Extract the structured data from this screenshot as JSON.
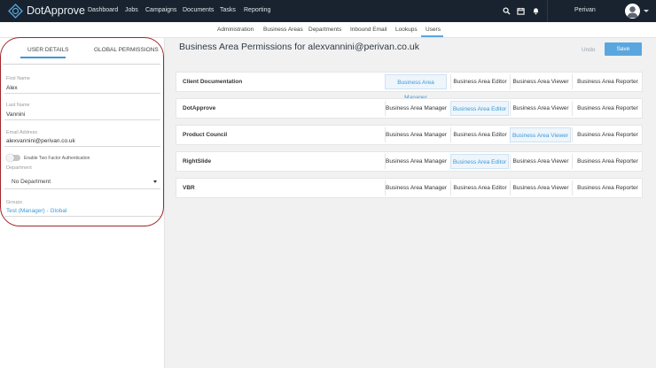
{
  "app": {
    "brand": "DotApprove",
    "nav": [
      "Dashboard",
      "Jobs",
      "Campaigns",
      "Documents",
      "Tasks",
      "Reporting"
    ],
    "icons": [
      "search-icon",
      "calendar-icon",
      "bell-icon"
    ],
    "user": "Perivan"
  },
  "subnav": {
    "items": [
      "Administration",
      "Business Areas",
      "Departments",
      "Inbound Email",
      "Lookups",
      "Users"
    ],
    "active": "Users"
  },
  "left": {
    "tabs": [
      "USER DETAILS",
      "GLOBAL PERMISSIONS"
    ],
    "active_tab": "USER DETAILS",
    "first_name_label": "First Name",
    "first_name": "Alex",
    "last_name_label": "Last Name",
    "last_name": "Vannini",
    "email_label": "Email Address",
    "email": "alexvannini@perivan.co.uk",
    "two_factor_label": "Enable Two Factor Authentication",
    "two_factor_enabled": false,
    "department_label": "Department",
    "department_value": "No Department",
    "groups_label": "Groups",
    "group_value": "Test (Manager) - Global"
  },
  "main": {
    "title": "Business Area Permissions for alexvannini@perivan.co.uk",
    "undo": "Undo",
    "save": "Save",
    "roles": [
      "Business Area Manager",
      "Business Area Editor",
      "Business Area Viewer",
      "Business Area Reporter"
    ],
    "rows": [
      {
        "name": "Client Documentation",
        "selected": "Business Area Manager"
      },
      {
        "name": "DotApprove",
        "selected": "Business Area Editor"
      },
      {
        "name": "Product Council",
        "selected": "Business Area Viewer"
      },
      {
        "name": "RightSlide",
        "selected": "Business Area Editor"
      },
      {
        "name": "VBR",
        "selected": ""
      }
    ]
  },
  "colors": {
    "topbar": "#19232f",
    "accent": "#5aa7e0",
    "link": "#3a9ad9",
    "highlight_ring": "#a3262c"
  }
}
